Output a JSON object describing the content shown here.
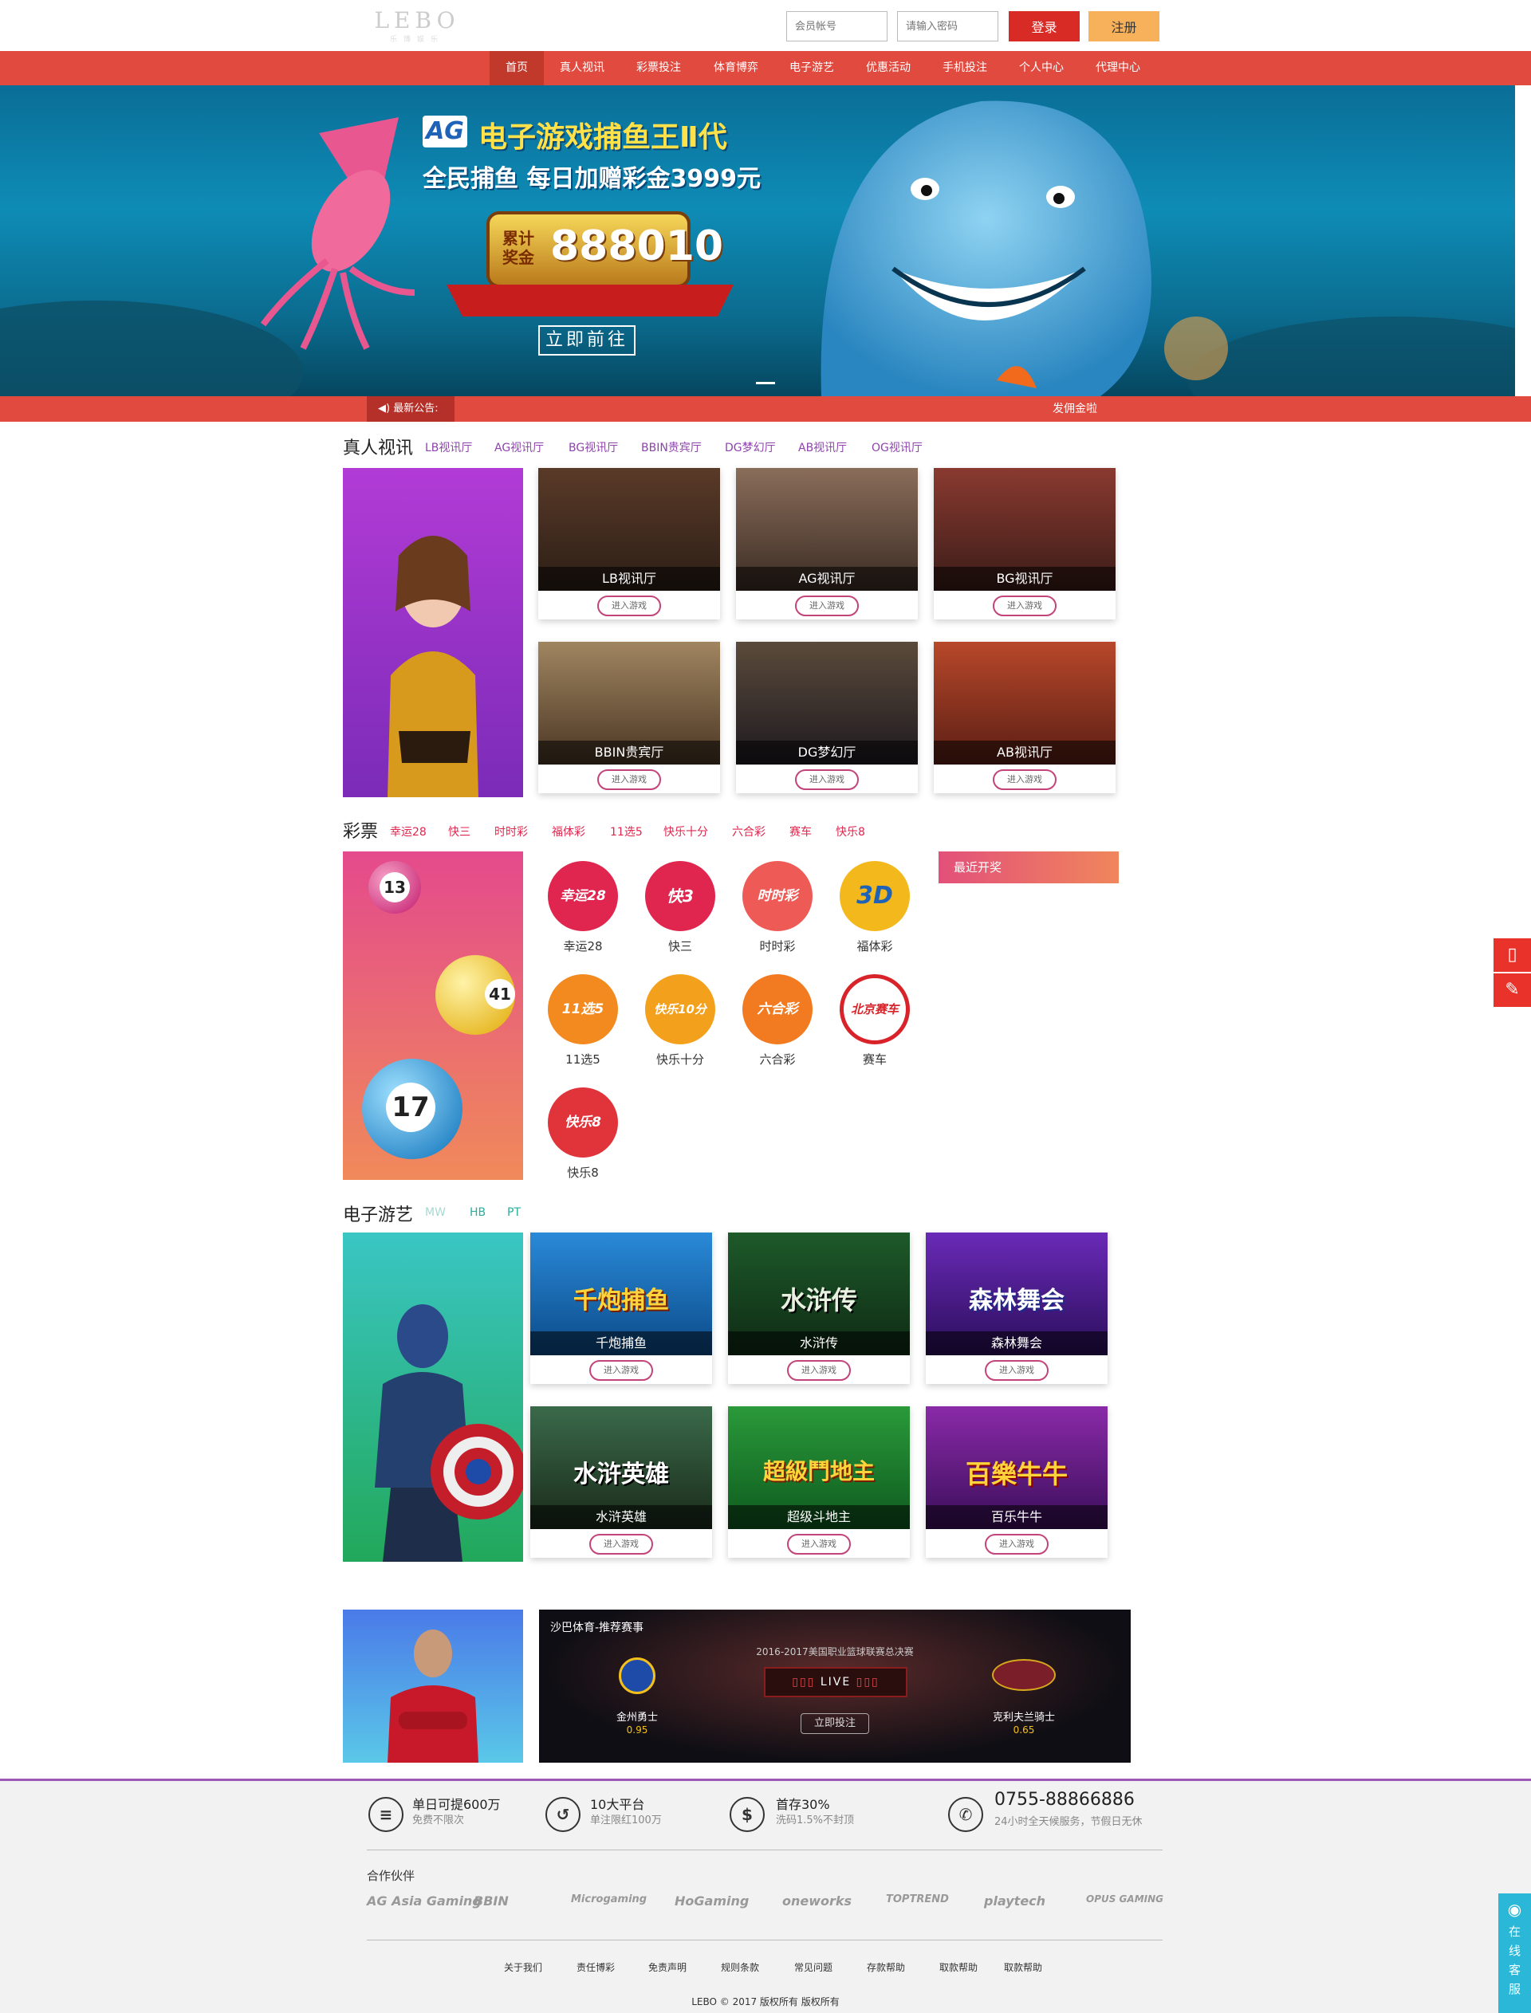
{
  "header": {
    "logo": "LEBO",
    "logo_sub": "乐博娱乐",
    "username_placeholder": "会员帐号",
    "password_placeholder": "请输入密码",
    "login_label": "登录",
    "register_label": "注册"
  },
  "nav": {
    "items": [
      "首页",
      "真人视讯",
      "彩票投注",
      "体育博弈",
      "电子游艺",
      "优惠活动",
      "手机投注",
      "个人中心",
      "代理中心"
    ]
  },
  "banner": {
    "brand": "AG",
    "headline": "电子游戏捕鱼王Ⅱ代",
    "subline": "全民捕鱼 每日加赠彩金3999元",
    "jackpot_label": "累计奖金",
    "jackpot_value": "888010",
    "cta": "立即前往"
  },
  "ticker": {
    "label": "最新公告:",
    "text": "发佣金啦"
  },
  "live": {
    "title": "真人视讯",
    "tabs": [
      "LB视讯厅",
      "AG视讯厅",
      "BG视讯厅",
      "BBIN贵宾厅",
      "DG梦幻厅",
      "AB视讯厅",
      "OG视讯厅"
    ],
    "cards": [
      "LB视讯厅",
      "AG视讯厅",
      "BG视讯厅",
      "BBIN贵宾厅",
      "DG梦幻厅",
      "AB视讯厅"
    ],
    "enter": "进入游戏"
  },
  "lottery": {
    "title": "彩票",
    "tabs": [
      "幸运28",
      "快三",
      "时时彩",
      "福体彩",
      "11选5",
      "快乐十分",
      "六合彩",
      "赛车",
      "快乐8"
    ],
    "items": [
      {
        "name": "幸运28",
        "logo": "幸运28",
        "color": "#e0264e"
      },
      {
        "name": "快三",
        "logo": "快3",
        "color": "#e0264e"
      },
      {
        "name": "时时彩",
        "logo": "时时彩",
        "color": "#ee5a56"
      },
      {
        "name": "福体彩",
        "logo": "3D",
        "color": "#f3b81c"
      },
      {
        "name": "11选5",
        "logo": "11选5",
        "color": "#f38a20"
      },
      {
        "name": "快乐十分",
        "logo": "快乐10分",
        "color": "#f3a11c"
      },
      {
        "name": "六合彩",
        "logo": "六合彩",
        "color": "#f27b22"
      },
      {
        "name": "赛车",
        "logo": "北京赛车",
        "color": "#d8232a"
      },
      {
        "name": "快乐8",
        "logo": "快乐8",
        "color": "#e0333a"
      }
    ],
    "recent_title": "最近开奖",
    "ball_numbers": [
      "13",
      "41",
      "17"
    ]
  },
  "egame": {
    "title": "电子游艺",
    "tabs": [
      "MW",
      "HB",
      "PT"
    ],
    "cards": [
      {
        "name": "千炮捕鱼",
        "logo": "千炮捕鱼"
      },
      {
        "name": "水浒传",
        "logo": "水浒传"
      },
      {
        "name": "森林舞会",
        "logo": "森林舞会"
      },
      {
        "name": "水浒英雄",
        "logo": "水浒英雄"
      },
      {
        "name": "超级斗地主",
        "logo": "超級鬥地主"
      },
      {
        "name": "百乐牛牛",
        "logo": "百樂牛牛"
      }
    ],
    "enter": "进入游戏"
  },
  "sports": {
    "title": "沙巴体育-推荐赛事",
    "event": "2016-2017美国职业篮球联赛总决赛",
    "live": "LIVE",
    "team_home": "金州勇士",
    "odds_home": "0.95",
    "team_away": "克利夫兰骑士",
    "odds_away": "0.65",
    "bet": "立即投注"
  },
  "footer": {
    "features": [
      {
        "title": "单日可提600万",
        "sub": "免费不限次",
        "icon": "money-icon"
      },
      {
        "title": "10大平台",
        "sub": "单注限红100万",
        "icon": "return-icon"
      },
      {
        "title": "首存30%",
        "sub": "洗码1.5%不封顶",
        "icon": "dollar-icon"
      },
      {
        "title": "0755-88866886",
        "sub": "24小时全天候服务，节假日无休",
        "icon": "phone-icon"
      }
    ],
    "partners_title": "合作伙伴",
    "partners": [
      "AG Asia Gaming",
      "BBIN",
      "Microgaming",
      "HoGaming",
      "oneworks",
      "TOPTREND",
      "playtech",
      "OPUS GAMING"
    ],
    "links": [
      "关于我们",
      "责任博彩",
      "免责声明",
      "规则条款",
      "常见问题",
      "存款帮助",
      "取款帮助",
      "取款帮助"
    ],
    "copyright": "LEBO © 2017 版权所有 版权所有"
  },
  "sidebar": {
    "service": "在线客服"
  }
}
